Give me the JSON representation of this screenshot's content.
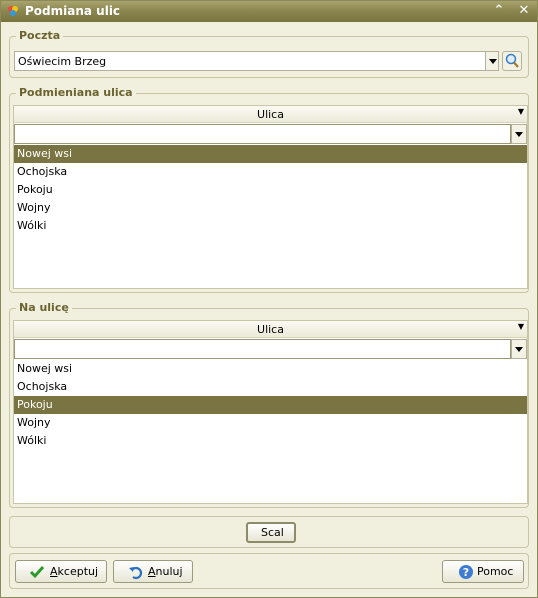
{
  "window": {
    "title": "Podmiana ulic"
  },
  "poczta": {
    "label": "Poczta",
    "value": "Oświecim Brzeg"
  },
  "source": {
    "label": "Podmieniana ulica",
    "column_header": "Ulica",
    "filter_value": "",
    "items": [
      "Nowej wsi",
      "Ochojska",
      "Pokoju",
      "Wojny",
      "Wólki"
    ],
    "selected_index": 0
  },
  "target": {
    "label": "Na ulicę",
    "column_header": "Ulica",
    "filter_value": "",
    "items": [
      "Nowej wsi",
      "Ochojska",
      "Pokoju",
      "Wojny",
      "Wólki"
    ],
    "selected_index": 2
  },
  "merge_button": "Scal",
  "buttons": {
    "accept_first": "A",
    "accept_rest": "kceptuj",
    "cancel_first": "A",
    "cancel_rest": "nuluj",
    "help": "Pomoc"
  },
  "colors": {
    "accent": "#7a7442",
    "window_bg": "#f1efde",
    "titlebar": "#8c8650",
    "label": "#6b6430"
  }
}
